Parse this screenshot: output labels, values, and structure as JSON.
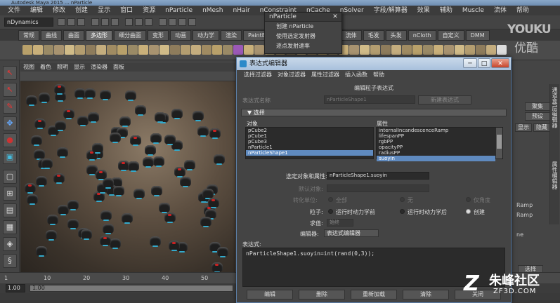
{
  "app": {
    "title_bar": "Autodesk Maya 2015 ... nParticle",
    "menubar": [
      "文件",
      "编辑",
      "修改",
      "创建",
      "显示",
      "窗口",
      "资源",
      "nParticle",
      "nMesh",
      "nHair",
      "nConstraint",
      "nCache",
      "nSolver",
      "字段/解算器",
      "效果",
      "辅助",
      "Muscle",
      "流体",
      "帮助"
    ],
    "mode": "nDynamics",
    "shelf_tabs": [
      "常规",
      "曲线",
      "曲面",
      "多边形",
      "细分曲面",
      "变形",
      "动画",
      "动力学",
      "渲染",
      "PaintEffects",
      "卡通",
      "Muscle",
      "流体",
      "毛发",
      "头发",
      "nCloth",
      "自定义",
      "DMM"
    ],
    "active_shelf": "多边形"
  },
  "viewport": {
    "menu": [
      "视图",
      "着色",
      "照明",
      "显示",
      "渲染器",
      "面板"
    ]
  },
  "timeline": {
    "ticks": [
      "1",
      "10",
      "20",
      "30",
      "40",
      "50",
      "60",
      "70",
      "80",
      "90",
      "100",
      "110"
    ],
    "range_start": "1.00",
    "range_bar": "1.00"
  },
  "right_panel": {
    "buttons": [
      "聚集",
      "预设"
    ],
    "small_buttons": [
      "显示",
      "隐藏"
    ],
    "list": [
      "Ramp",
      "Ramp",
      "ne"
    ],
    "vertical_tabs": [
      "通道盒/层编辑器",
      "属性编辑器"
    ],
    "bottom_btn": "选择"
  },
  "np_menu": {
    "title": "nParticle",
    "close": "✕",
    "items": [
      "创建 nParticle",
      "使用选定发射器",
      "逐点发射速率"
    ]
  },
  "expr_editor": {
    "title": "表达式编辑器",
    "menu": [
      "选择过滤器",
      "对象过滤器",
      "属性过滤器",
      "插入函数",
      "帮助"
    ],
    "heading": "编辑粒子表达式",
    "name_label": "表达式名称",
    "name_value": "nParticleShape1",
    "create_button": "新建表达式",
    "select_header": "▼ 选择",
    "objects_label": "对象",
    "attributes_label": "属性",
    "objects": [
      "pCube2",
      "pCube1",
      "pCube3",
      "nParticle1",
      "nParticleShape1"
    ],
    "selected_object": 4,
    "attributes": [
      "internalIncandescenceRamp",
      "lifespanPP",
      "rgbPP",
      "opacityPP",
      "radiusPP",
      "suoyin"
    ],
    "selected_attribute": 5,
    "sel_obj_attr_label": "选定对象和属性:",
    "sel_obj_attr_value": "nParticleShape1.suoyin",
    "default_obj_label": "默认对象:",
    "convert_label": "转化单位:",
    "convert_options": [
      "全部",
      "无",
      "仅角度"
    ],
    "particle_label": "粒子:",
    "particle_options": [
      "运行时动力学前",
      "运行时动力学后",
      "创建"
    ],
    "particle_selected": 2,
    "evaluate_label": "求值:",
    "evaluate_value": "始终",
    "editor_label": "编辑器:",
    "editor_value": "表达式编辑器",
    "expr_label": "表达式:",
    "expression": "nParticleShape1.suoyin=int(rand(0,3));",
    "buttons": [
      "编辑",
      "删除",
      "重新加载",
      "清除",
      "关闭"
    ],
    "window_buttons": [
      "─",
      "□",
      "✕"
    ]
  },
  "watermarks": {
    "youku_en": "YOUKU",
    "youku_cn": "优酷",
    "zf_name": "朱峰社区",
    "zf_url": "ZF3D.COM",
    "zf_logo": "Z"
  }
}
